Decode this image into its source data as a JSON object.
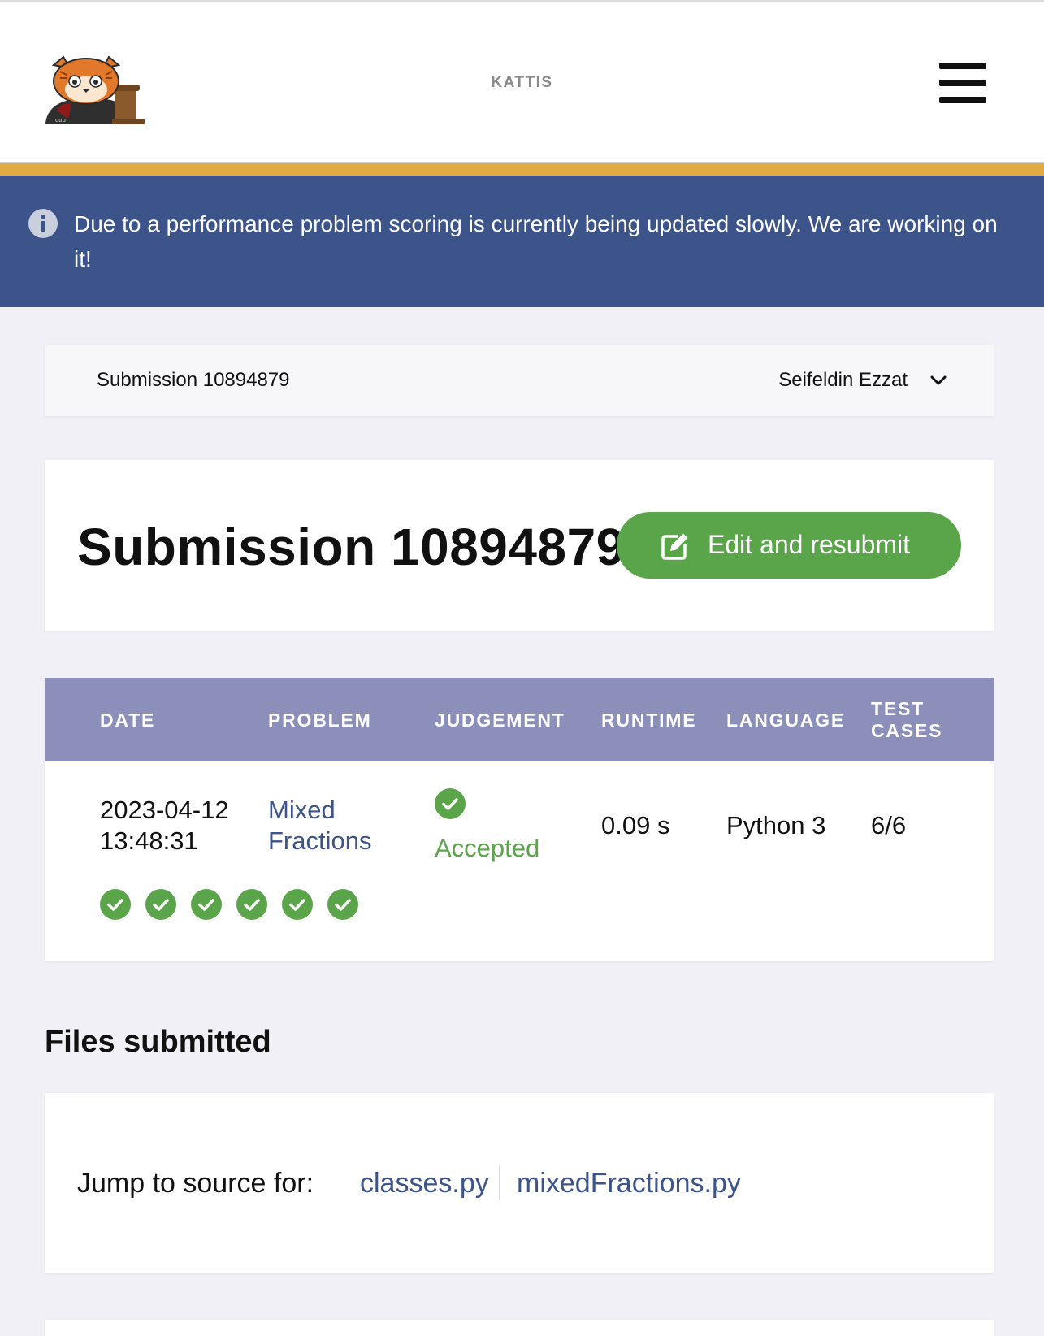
{
  "header": {
    "brand": "KATTIS"
  },
  "notice": {
    "text": "Due to a performance problem scoring is currently being updated slowly. We are working on it!"
  },
  "breadcrumb": {
    "title": "Submission 10894879",
    "user": "Seifeldin Ezzat"
  },
  "title_card": {
    "title": "Submission 10894879",
    "resubmit_label": "Edit and resubmit"
  },
  "table": {
    "headers": {
      "date": "DATE",
      "problem": "PROBLEM",
      "judgement": "JUDGEMENT",
      "runtime": "RUNTIME",
      "language": "LANGUAGE",
      "test_cases_1": "TEST",
      "test_cases_2": "CASES"
    },
    "row": {
      "date": "2023-04-12",
      "time": "13:48:31",
      "problem_1": "Mixed",
      "problem_2": "Fractions",
      "judgement": "Accepted",
      "runtime": "0.09 s",
      "language": "Python 3",
      "test_cases": "6/6",
      "test_results_passed": 6
    }
  },
  "files": {
    "section_title": "Files submitted",
    "jump_label": "Jump to source for:",
    "file_1": "classes.py",
    "file_2": "mixedFractions.py"
  },
  "colors": {
    "accent_gold": "#e2ab41",
    "notice_blue": "#3d548b",
    "table_header": "#8b8fb9",
    "success_green": "#5aa449",
    "link_blue": "#3d548b"
  },
  "icons": {
    "logo": "kattis-cat-logo",
    "menu": "hamburger-icon",
    "info": "info-icon",
    "dropdown": "chevron-down-icon",
    "edit": "edit-icon",
    "check": "check-circle-icon"
  }
}
